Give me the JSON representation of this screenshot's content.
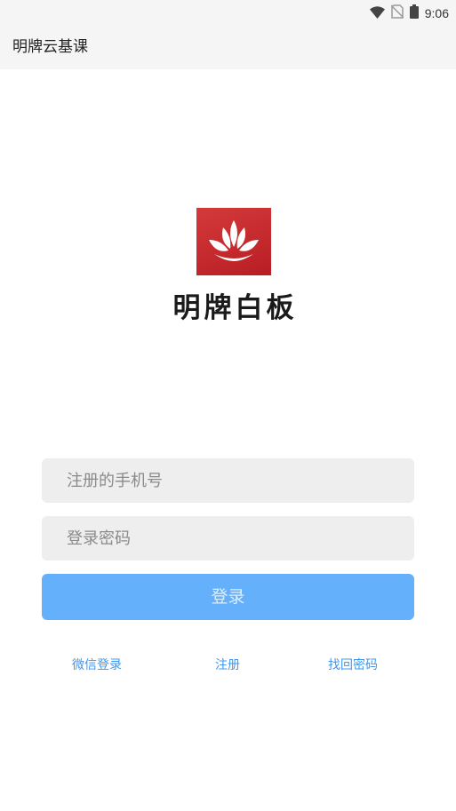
{
  "status_bar": {
    "time": "9:06",
    "icons": [
      "wifi-icon",
      "no-sim-icon",
      "battery-icon"
    ]
  },
  "app_bar": {
    "title": "明牌云基课"
  },
  "brand": {
    "logo_icon": "lotus-icon",
    "name": "明牌白板"
  },
  "login_form": {
    "phone_placeholder": "注册的手机号",
    "password_placeholder": "登录密码",
    "login_label": "登录"
  },
  "links": {
    "wechat_login": "微信登录",
    "register": "注册",
    "forgot_password": "找回密码"
  },
  "colors": {
    "accent": "#64b0fb",
    "link": "#3d97ef",
    "logo_red": "#c62a2f"
  }
}
